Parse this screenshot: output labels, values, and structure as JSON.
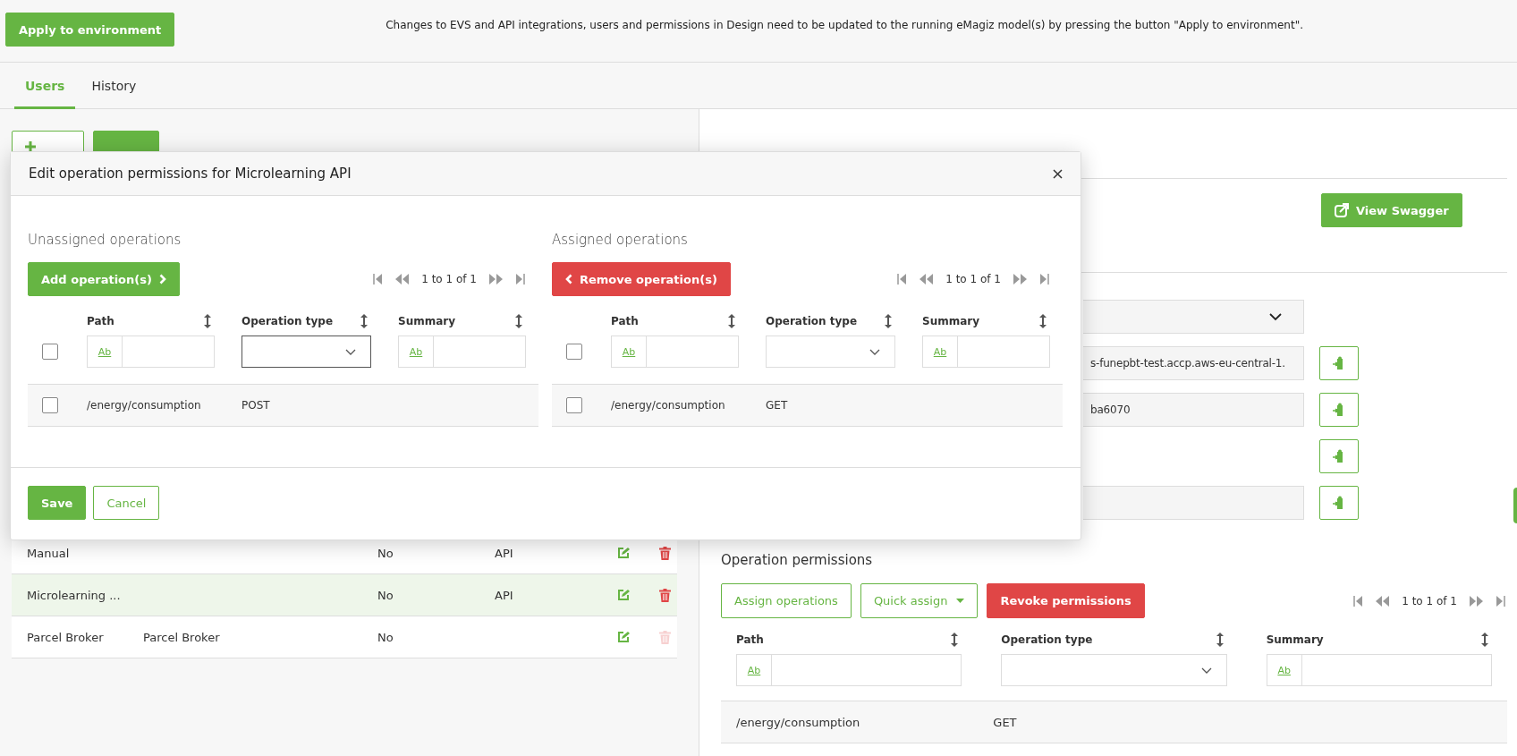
{
  "toolbar": {
    "apply_button": "Apply to environment",
    "message": "Changes to EVS and API integrations, users and permissions in Design need to be updated to the running eMagiz model(s) by pressing the button \"Apply to environment\"."
  },
  "tabs": [
    {
      "label": "Users",
      "selected": true
    },
    {
      "label": "History",
      "selected": false
    }
  ],
  "users": {
    "rows": [
      {
        "cells": [
          "Manual",
          "",
          "No",
          "API"
        ],
        "selected": false,
        "delete_disabled": false
      },
      {
        "cells": [
          "Microlearning ...",
          "",
          "No",
          "API"
        ],
        "selected": true,
        "delete_disabled": false
      },
      {
        "cells": [
          "Parcel Broker",
          "Parcel Broker",
          "No",
          ""
        ],
        "selected": false,
        "delete_disabled": true
      }
    ]
  },
  "api_detail": {
    "view_button": "View Swagger",
    "fields": [
      {
        "kind": "select"
      },
      {
        "kind": "text",
        "value": "s-funepbt-test.accp.aws-eu-central-1."
      },
      {
        "kind": "text",
        "value": "ba6070"
      },
      {
        "kind": "button_only"
      },
      {
        "kind": "text"
      }
    ]
  },
  "operation_permissions": {
    "title": "Operation permissions",
    "buttons": [
      {
        "label": "Assign operations",
        "kind": "outline"
      },
      {
        "label": "Quick assign",
        "kind": "dropdown"
      },
      {
        "label": "Revoke permissions",
        "kind": "danger"
      }
    ],
    "pager": "1 to 1 of 1",
    "columns": [
      {
        "label": "Path",
        "kind": "text",
        "filter_label": "Ab"
      },
      {
        "label": "Operation type",
        "kind": "select"
      },
      {
        "label": "Summary",
        "kind": "text",
        "filter_label": "Ab"
      }
    ],
    "rows": [
      {
        "cells": [
          "/energy/consumption",
          "GET",
          ""
        ]
      }
    ]
  },
  "modal": {
    "title": "Edit operation permissions for Microlearning API",
    "sections": [
      {
        "title": "Unassigned operations",
        "action": {
          "label": "Add operation(s)",
          "kind": "add"
        },
        "pager": "1 to 1 of 1",
        "all_checked": false,
        "select_focused": true,
        "columns": [
          {
            "label": "Path",
            "kind": "text",
            "filter_label": "Ab"
          },
          {
            "label": "Operation type",
            "kind": "select"
          },
          {
            "label": "Summary",
            "kind": "text",
            "filter_label": "Ab"
          }
        ],
        "rows": [
          {
            "checked": false,
            "cells": [
              "/energy/consumption",
              "POST",
              ""
            ]
          }
        ]
      },
      {
        "title": "Assigned operations",
        "action": {
          "label": "Remove operation(s)",
          "kind": "remove"
        },
        "pager": "1 to 1 of 1",
        "all_checked": false,
        "select_focused": false,
        "columns": [
          {
            "label": "Path",
            "kind": "text",
            "filter_label": "Ab"
          },
          {
            "label": "Operation type",
            "kind": "select"
          },
          {
            "label": "Summary",
            "kind": "text",
            "filter_label": "Ab"
          }
        ],
        "rows": [
          {
            "checked": false,
            "cells": [
              "/energy/consumption",
              "GET",
              ""
            ]
          }
        ]
      }
    ],
    "footer_buttons": [
      {
        "label": "Save",
        "kind": "primary"
      },
      {
        "label": "Cancel",
        "kind": "secondary"
      }
    ]
  }
}
